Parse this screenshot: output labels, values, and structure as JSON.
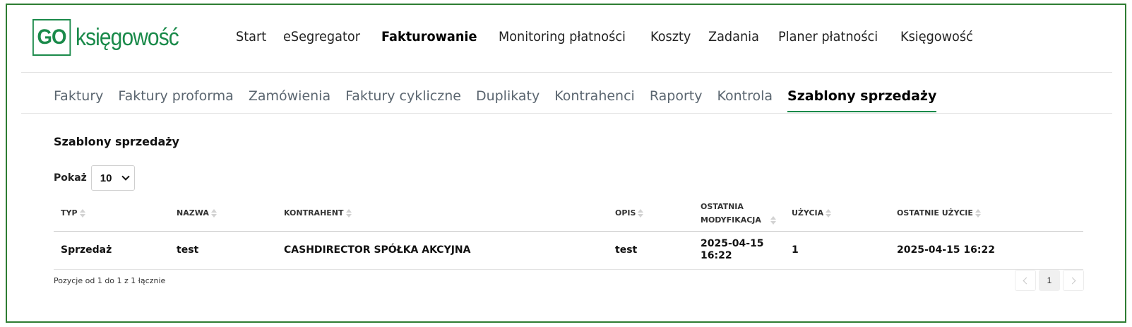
{
  "brand": {
    "box": "GO",
    "text": "księgowość",
    "color": "#1a8a4a"
  },
  "main_nav": [
    {
      "label": "Start",
      "active": false
    },
    {
      "label": "eSegregator",
      "active": false
    },
    {
      "label": "Fakturowanie",
      "active": true
    },
    {
      "label": "Monitoring płatności",
      "active": false
    },
    {
      "label": "Koszty",
      "active": false
    },
    {
      "label": "Zadania",
      "active": false
    },
    {
      "label": "Planer płatności",
      "active": false
    },
    {
      "label": "Księgowość",
      "active": false
    }
  ],
  "sub_nav": [
    {
      "label": "Faktury",
      "active": false
    },
    {
      "label": "Faktury proforma",
      "active": false
    },
    {
      "label": "Zamówienia",
      "active": false
    },
    {
      "label": "Faktury cykliczne",
      "active": false
    },
    {
      "label": "Duplikaty",
      "active": false
    },
    {
      "label": "Kontrahenci",
      "active": false
    },
    {
      "label": "Raporty",
      "active": false
    },
    {
      "label": "Kontrola",
      "active": false
    },
    {
      "label": "Szablony sprzedaży",
      "active": true
    }
  ],
  "page": {
    "title": "Szablony sprzedaży",
    "show_label": "Pokaż",
    "show_value": "10"
  },
  "table": {
    "headers": [
      "TYP",
      "NAZWA",
      "KONTRAHENT",
      "OPIS",
      "OSTATNIA MODYFIKACJA",
      "UŻYCIA",
      "OSTATNIE UŻYCIE"
    ],
    "rows": [
      [
        "Sprzedaż",
        "test",
        "CASHDIRECTOR SPÓŁKA AKCYJNA",
        "test",
        "2025-04-15 16:22",
        "1",
        "2025-04-15 16:22"
      ]
    ]
  },
  "footer": {
    "info": "Pozycje od 1 do 1 z 1 łącznie",
    "current_page": "1"
  },
  "colors": {
    "accent": "#1a8a4a",
    "frame": "#2e7d32"
  }
}
